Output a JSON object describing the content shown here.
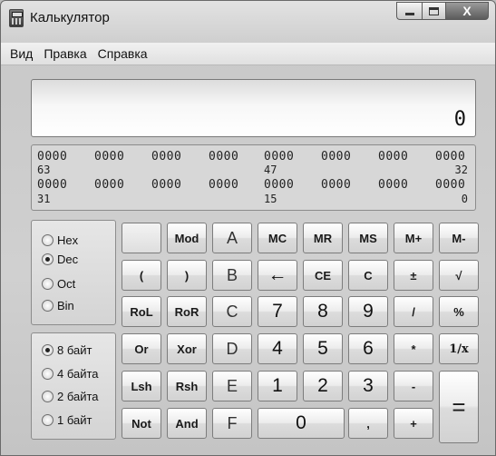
{
  "window": {
    "title": "Калькулятор",
    "close_label": "X"
  },
  "menu": {
    "view": "Вид",
    "edit": "Правка",
    "help": "Справка"
  },
  "display": {
    "value": "0"
  },
  "bits": {
    "row1": [
      "0000",
      "0000",
      "0000",
      "0000",
      "0000",
      "0000",
      "0000",
      "0000"
    ],
    "row1_marks": [
      "63",
      "47",
      "32"
    ],
    "row2": [
      "0000",
      "0000",
      "0000",
      "0000",
      "0000",
      "0000",
      "0000",
      "0000"
    ],
    "row2_marks": [
      "31",
      "15",
      "0"
    ]
  },
  "base": {
    "hex": "Hex",
    "dec": "Dec",
    "oct": "Oct",
    "bin": "Bin",
    "selected": "Dec"
  },
  "word": {
    "qword": "8 байт",
    "dword": "4 байта",
    "word": "2 байта",
    "byte": "1 байт",
    "selected": "8 байт"
  },
  "keys": {
    "mod": "Mod",
    "lparen": "(",
    "rparen": ")",
    "rol": "RoL",
    "ror": "RoR",
    "or": "Or",
    "xor": "Xor",
    "lsh": "Lsh",
    "rsh": "Rsh",
    "not": "Not",
    "and": "And",
    "a": "A",
    "b": "B",
    "c": "C",
    "d": "D",
    "e": "E",
    "f": "F",
    "mc": "MC",
    "mr": "MR",
    "ms": "MS",
    "mplus": "M+",
    "mminus": "M-",
    "backspace": "←",
    "ce": "CE",
    "clear": "C",
    "plusminus": "±",
    "sqrt": "√",
    "n7": "7",
    "n8": "8",
    "n9": "9",
    "div": "/",
    "pct": "%",
    "n4": "4",
    "n5": "5",
    "n6": "6",
    "mul": "*",
    "recip": "1/x",
    "n1": "1",
    "n2": "2",
    "n3": "3",
    "sub": "-",
    "eq": "=",
    "n0": "0",
    "dot": ",",
    "add": "+"
  }
}
